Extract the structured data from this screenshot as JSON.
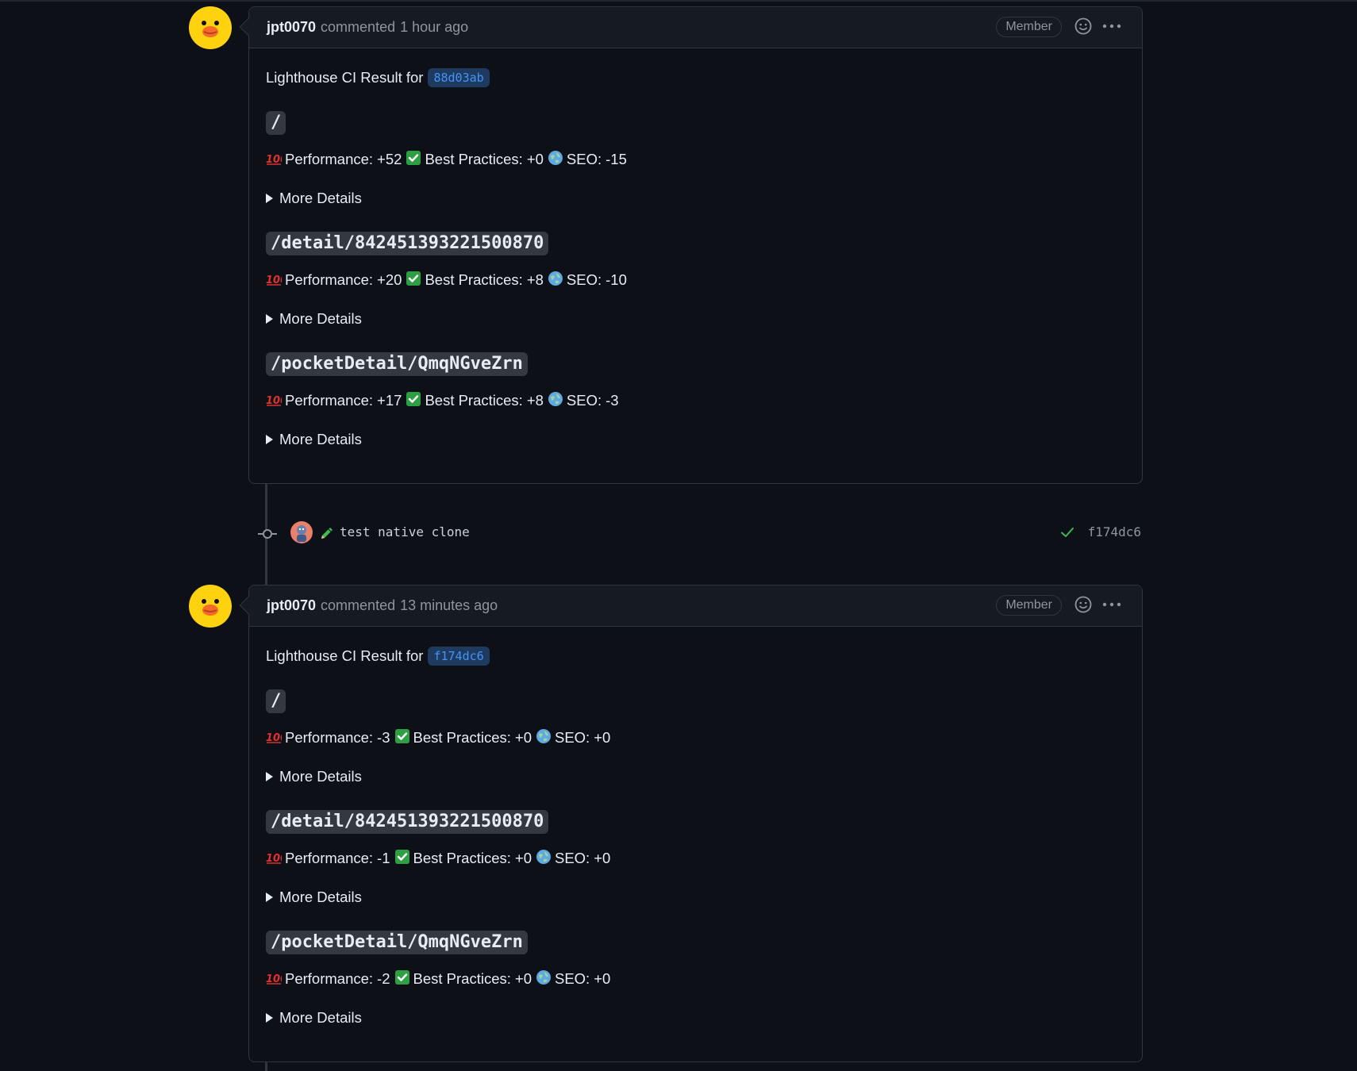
{
  "comments": [
    {
      "author": "jpt0070",
      "action": "commented",
      "time": "1 hour ago",
      "badge": "Member",
      "result_prefix": "Lighthouse CI Result for",
      "commit_sha": "88d03ab",
      "routes": [
        {
          "path": "/",
          "perf_label": "Performance:",
          "perf": "+52",
          "bp_label": "Best Practices:",
          "bp": "+0",
          "seo_label": "SEO:",
          "seo": "-15",
          "details": "More Details"
        },
        {
          "path": "/detail/842451393221500870",
          "perf_label": "Performance:",
          "perf": "+20",
          "bp_label": "Best Practices:",
          "bp": "+8",
          "seo_label": "SEO:",
          "seo": "-10",
          "details": "More Details"
        },
        {
          "path": "/pocketDetail/QmqNGveZrn",
          "perf_label": "Performance:",
          "perf": "+17",
          "bp_label": "Best Practices:",
          "bp": "+8",
          "seo_label": "SEO:",
          "seo": "-3",
          "details": "More Details"
        }
      ]
    },
    {
      "author": "jpt0070",
      "action": "commented",
      "time": "13 minutes ago",
      "badge": "Member",
      "result_prefix": "Lighthouse CI Result for",
      "commit_sha": "f174dc6",
      "routes": [
        {
          "path": "/",
          "perf_label": "Performance:",
          "perf": "-3",
          "bp_label": "Best Practices:",
          "bp": "+0",
          "seo_label": "SEO:",
          "seo": "+0",
          "details": "More Details"
        },
        {
          "path": "/detail/842451393221500870",
          "perf_label": "Performance:",
          "perf": "-1",
          "bp_label": "Best Practices:",
          "bp": "+0",
          "seo_label": "SEO:",
          "seo": "+0",
          "details": "More Details"
        },
        {
          "path": "/pocketDetail/QmqNGveZrn",
          "perf_label": "Performance:",
          "perf": "-2",
          "bp_label": "Best Practices:",
          "bp": "+0",
          "seo_label": "SEO:",
          "seo": "+0",
          "details": "More Details"
        }
      ]
    }
  ],
  "commit": {
    "message": "test native clone",
    "sha": "f174dc6",
    "status": "success"
  },
  "icons": {
    "perf": "hundred-points-icon",
    "bp": "check-mark-button-icon",
    "seo": "globe-icon",
    "commit_emoji": "pencil-icon"
  },
  "colors": {
    "background": "#0d1117",
    "header": "#161b22",
    "border": "#30363d",
    "link": "#4493f8",
    "success": "#3fb950",
    "muted": "#8d96a0"
  }
}
